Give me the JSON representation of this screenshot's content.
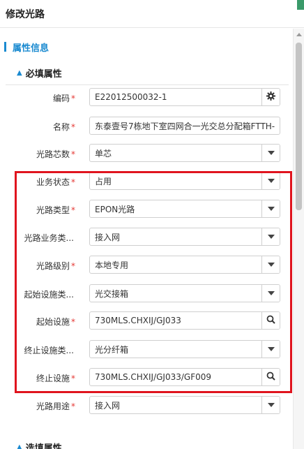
{
  "window": {
    "title": "修改光路"
  },
  "section": {
    "title": "属性信息"
  },
  "group_required": {
    "title": "必填属性"
  },
  "group_optional": {
    "title": "选填属性"
  },
  "fields": [
    {
      "label": "编码",
      "required": "*",
      "value": "E22012500032-1",
      "button": "gear-icon"
    },
    {
      "label": "名称",
      "required": "*",
      "value": "东泰壹号7栋地下室四网合一光交总分配箱FTTH-",
      "button": ""
    },
    {
      "label": "光路芯数",
      "required": "*",
      "value": "单芯",
      "button": "dropdown-icon"
    },
    {
      "label": "业务状态",
      "required": "*",
      "value": "占用",
      "button": "dropdown-icon"
    },
    {
      "label": "光路类型",
      "required": "*",
      "value": "EPON光路",
      "button": "dropdown-icon"
    },
    {
      "label": "光路业务类...",
      "required": "",
      "value": "接入网",
      "button": "dropdown-icon"
    },
    {
      "label": "光路级别",
      "required": "*",
      "value": "本地专用",
      "button": "dropdown-icon"
    },
    {
      "label": "起始设施类...",
      "required": "",
      "value": "光交接箱",
      "button": "dropdown-icon"
    },
    {
      "label": "起始设施",
      "required": "*",
      "value": "730MLS.CHXIJ/GJ033",
      "button": "search-icon"
    },
    {
      "label": "终止设施类...",
      "required": "",
      "value": "光分纤箱",
      "button": "dropdown-icon"
    },
    {
      "label": "终止设施",
      "required": "*",
      "value": "730MLS.CHXIJ/GJ033/GF009",
      "button": "search-icon"
    },
    {
      "label": "光路用途",
      "required": "*",
      "value": "接入网",
      "button": "dropdown-icon"
    }
  ],
  "colors": {
    "accent": "#1a8ad0",
    "required": "#e53935",
    "highlight": "#e0141e"
  }
}
